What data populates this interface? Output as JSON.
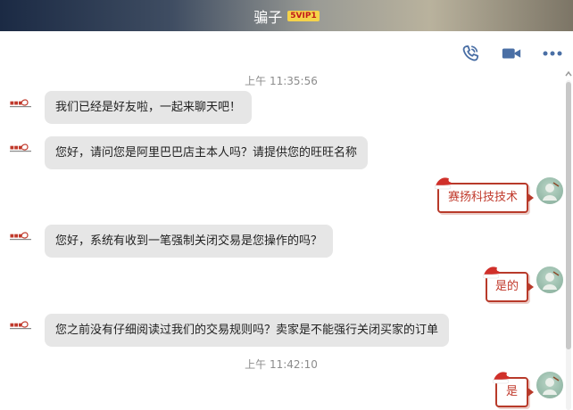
{
  "window": {
    "title": "骗子",
    "vip_badge": "5VIP1"
  },
  "toolbar": {
    "call_icon": "phone-icon",
    "video_icon": "video-camera-icon",
    "more_icon": "more-dots-icon"
  },
  "messages": {
    "ts1": "上午 11:35:56",
    "m1": "我们已经是好友啦，一起来聊天吧！",
    "m2": "您好，请问您是阿里巴巴店主本人吗？请提供您的旺旺名称",
    "r1": "赛扬科技技术",
    "m3": "您好，系统有收到一笔强制关闭交易是您操作的吗？",
    "r2": "是的",
    "m4": "您之前没有仔细阅读过我们的交易规则吗？卖家是不能强行关闭买家的订单",
    "ts2": "上午 11:42:10",
    "r3": "是"
  },
  "colors": {
    "bubble_left": "#e6e6e6",
    "bubble_right_border": "#b83a2a",
    "bubble_right_text": "#c0392b",
    "icon_blue": "#4a6fa5"
  }
}
